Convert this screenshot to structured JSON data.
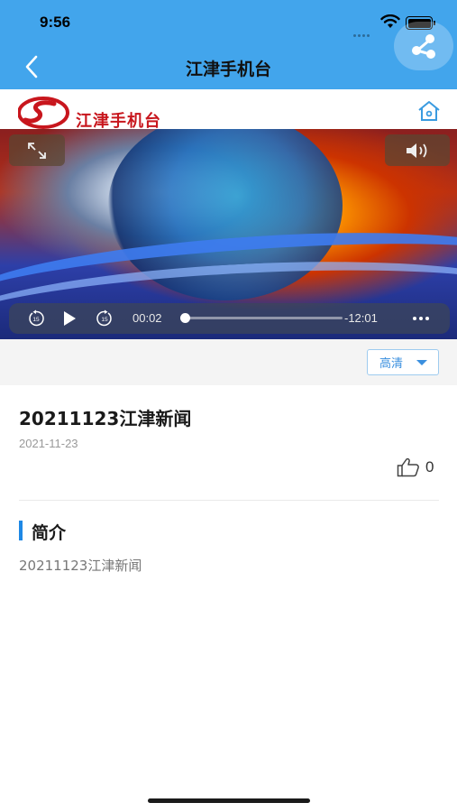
{
  "status_bar": {
    "time": "9:56"
  },
  "nav": {
    "title": "江津手机台"
  },
  "brand": {
    "logo_text": "江津手机台"
  },
  "player": {
    "current_time": "00:02",
    "remaining_time": "-12:01",
    "progress_percent": 3
  },
  "quality": {
    "selected": "高清"
  },
  "news": {
    "title": "20211123江津新闻",
    "date": "2021-11-23",
    "like_count": "0"
  },
  "intro": {
    "heading": "简介",
    "text": "20211123江津新闻"
  },
  "icons": {
    "back": "back-arrow-icon",
    "share": "share-icon",
    "home": "home-icon",
    "fullscreen": "fullscreen-icon",
    "volume": "volume-icon",
    "rewind": "rewind-15-icon",
    "play": "play-icon",
    "forward": "forward-15-icon",
    "more": "more-icon",
    "like": "thumbs-up-icon"
  },
  "colors": {
    "header": "#42a5ec",
    "accent": "#1e88e5",
    "brand_red": "#c8161d"
  }
}
